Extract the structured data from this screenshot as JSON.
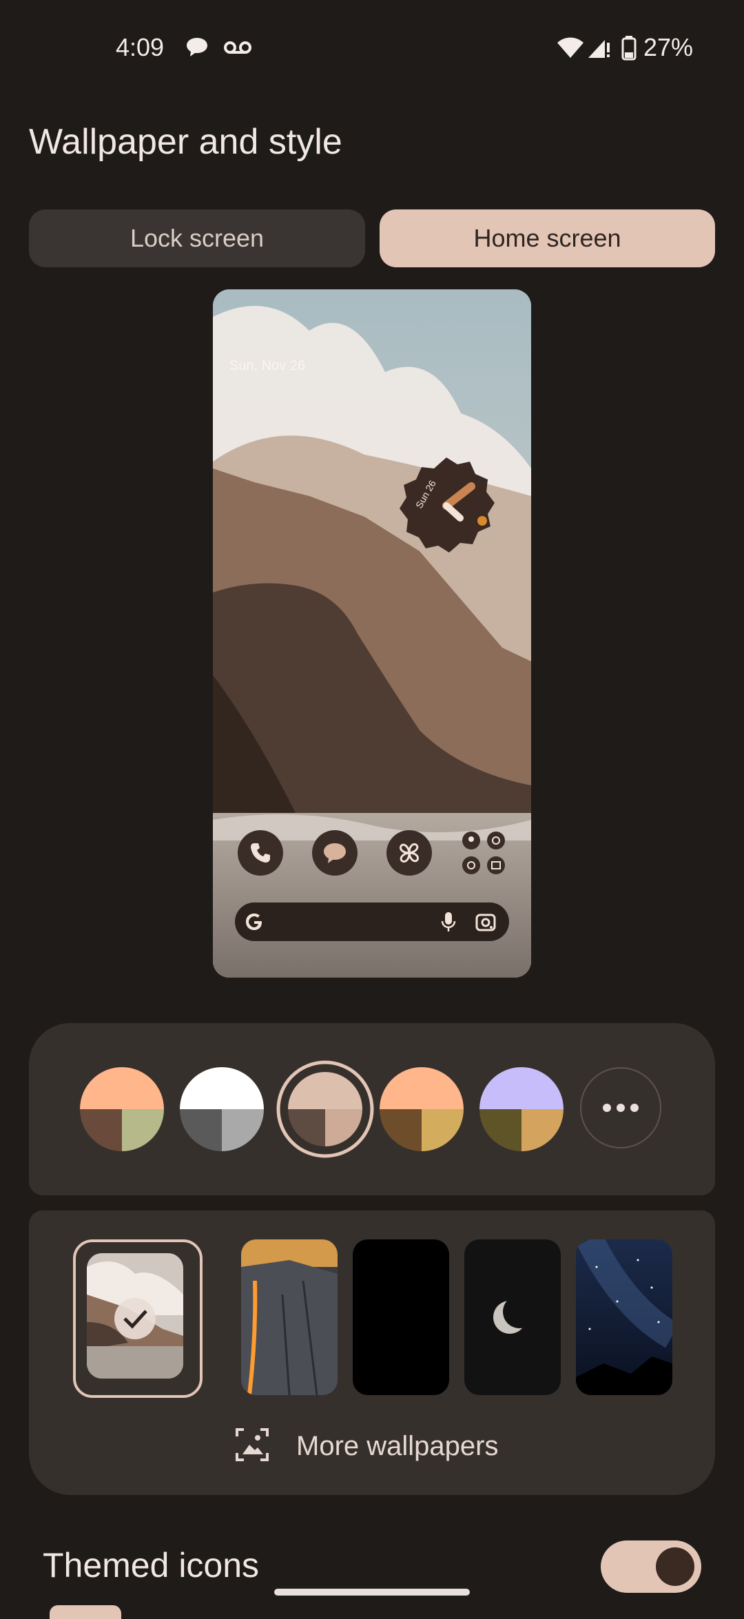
{
  "status_bar": {
    "time": "4:09",
    "battery": "27%",
    "icons": [
      "messages-icon",
      "voicemail-icon",
      "wifi-icon",
      "signal-icon",
      "battery-icon"
    ]
  },
  "header": {
    "title": "Wallpaper and style"
  },
  "tabs": [
    {
      "label": "Lock screen",
      "selected": false
    },
    {
      "label": "Home screen",
      "selected": true
    }
  ],
  "preview": {
    "date": "Sun, Nov 26",
    "clock_day": "Sun 26",
    "dock_icons": [
      "phone-icon",
      "messages-icon",
      "pinwheel-icon",
      "apps-folder-icon"
    ],
    "search_icons": [
      "google-g-icon",
      "mic-icon",
      "lens-icon"
    ]
  },
  "palette": {
    "options": [
      {
        "top": "#ffb68a",
        "bottom_left": "#6a4a3a",
        "bottom_right": "#b6b98a",
        "selected": false
      },
      {
        "top": "#ffffff",
        "bottom_left": "#5a5a5a",
        "bottom_right": "#a9a9a9",
        "selected": false
      },
      {
        "top": "#dcbfad",
        "bottom_left": "#5e4b42",
        "bottom_right": "#cdab97",
        "selected": true
      },
      {
        "top": "#ffb68a",
        "bottom_left": "#6e4d2a",
        "bottom_right": "#d4ac5e",
        "selected": false
      },
      {
        "top": "#c8bdfb",
        "bottom_left": "#5e5428",
        "bottom_right": "#d4a45e",
        "selected": false
      }
    ],
    "more_icon": "more-horizontal-icon"
  },
  "wallpapers": {
    "items": [
      {
        "name": "coastal-cliffs",
        "selected": true
      },
      {
        "name": "firefall",
        "selected": false
      },
      {
        "name": "black",
        "selected": false
      },
      {
        "name": "moon",
        "selected": false
      },
      {
        "name": "starry-sky",
        "selected": false
      }
    ],
    "more_label": "More wallpapers"
  },
  "themed_icons": {
    "label": "Themed icons",
    "enabled": true
  },
  "colors": {
    "accent": "#e3c5b6",
    "background": "#1f1b19",
    "card": "#36302d"
  }
}
